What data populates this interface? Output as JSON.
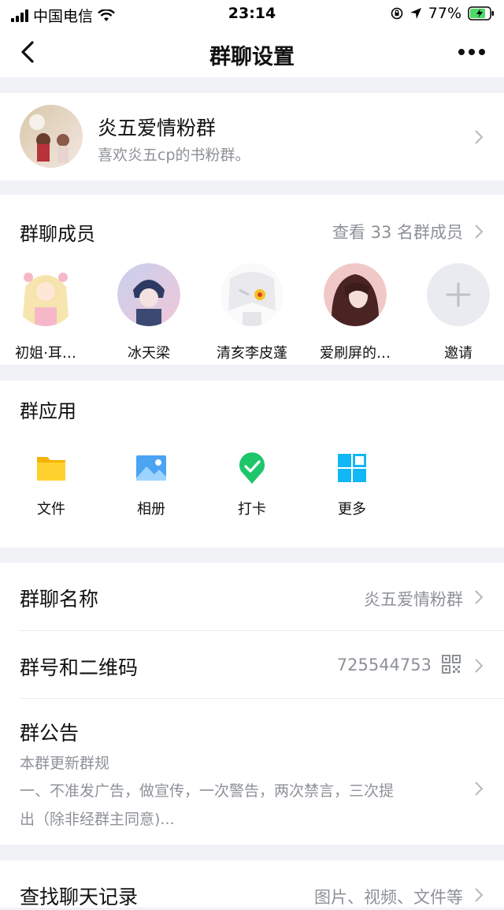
{
  "status_bar": {
    "carrier": "中国电信",
    "time": "23:14",
    "battery": "77%"
  },
  "nav": {
    "title": "群聊设置"
  },
  "group": {
    "name": "炎五爱情粉群",
    "description": "喜欢炎五cp的书粉群。"
  },
  "members": {
    "heading": "群聊成员",
    "view_all": "查看 33 名群成员",
    "list": [
      {
        "name": "初姐·耳…"
      },
      {
        "name": "冰天梁"
      },
      {
        "name": "清亥李皮蓬"
      },
      {
        "name": "爱刷屏的…"
      }
    ],
    "invite_label": "邀请"
  },
  "apps": {
    "heading": "群应用",
    "items": [
      {
        "label": "文件",
        "icon": "folder-icon"
      },
      {
        "label": "相册",
        "icon": "photo-icon"
      },
      {
        "label": "打卡",
        "icon": "checkin-icon"
      },
      {
        "label": "更多",
        "icon": "grid-icon"
      }
    ]
  },
  "settings": {
    "name_label": "群聊名称",
    "name_value": "炎五爱情粉群",
    "number_label": "群号和二维码",
    "number_value": "725544753",
    "notice_label": "群公告",
    "notice_line1": "本群更新群规",
    "notice_line2": "一、不准发广告，做宣传，一次警告，两次禁言，三次提",
    "notice_line3": "出（除非经群主同意)...",
    "search_label": "查找聊天记录",
    "search_value": "图片、视频、文件等"
  },
  "colors": {
    "accent": "#12b7f5",
    "background": "#f1f2f6",
    "muted": "#8d9197"
  }
}
